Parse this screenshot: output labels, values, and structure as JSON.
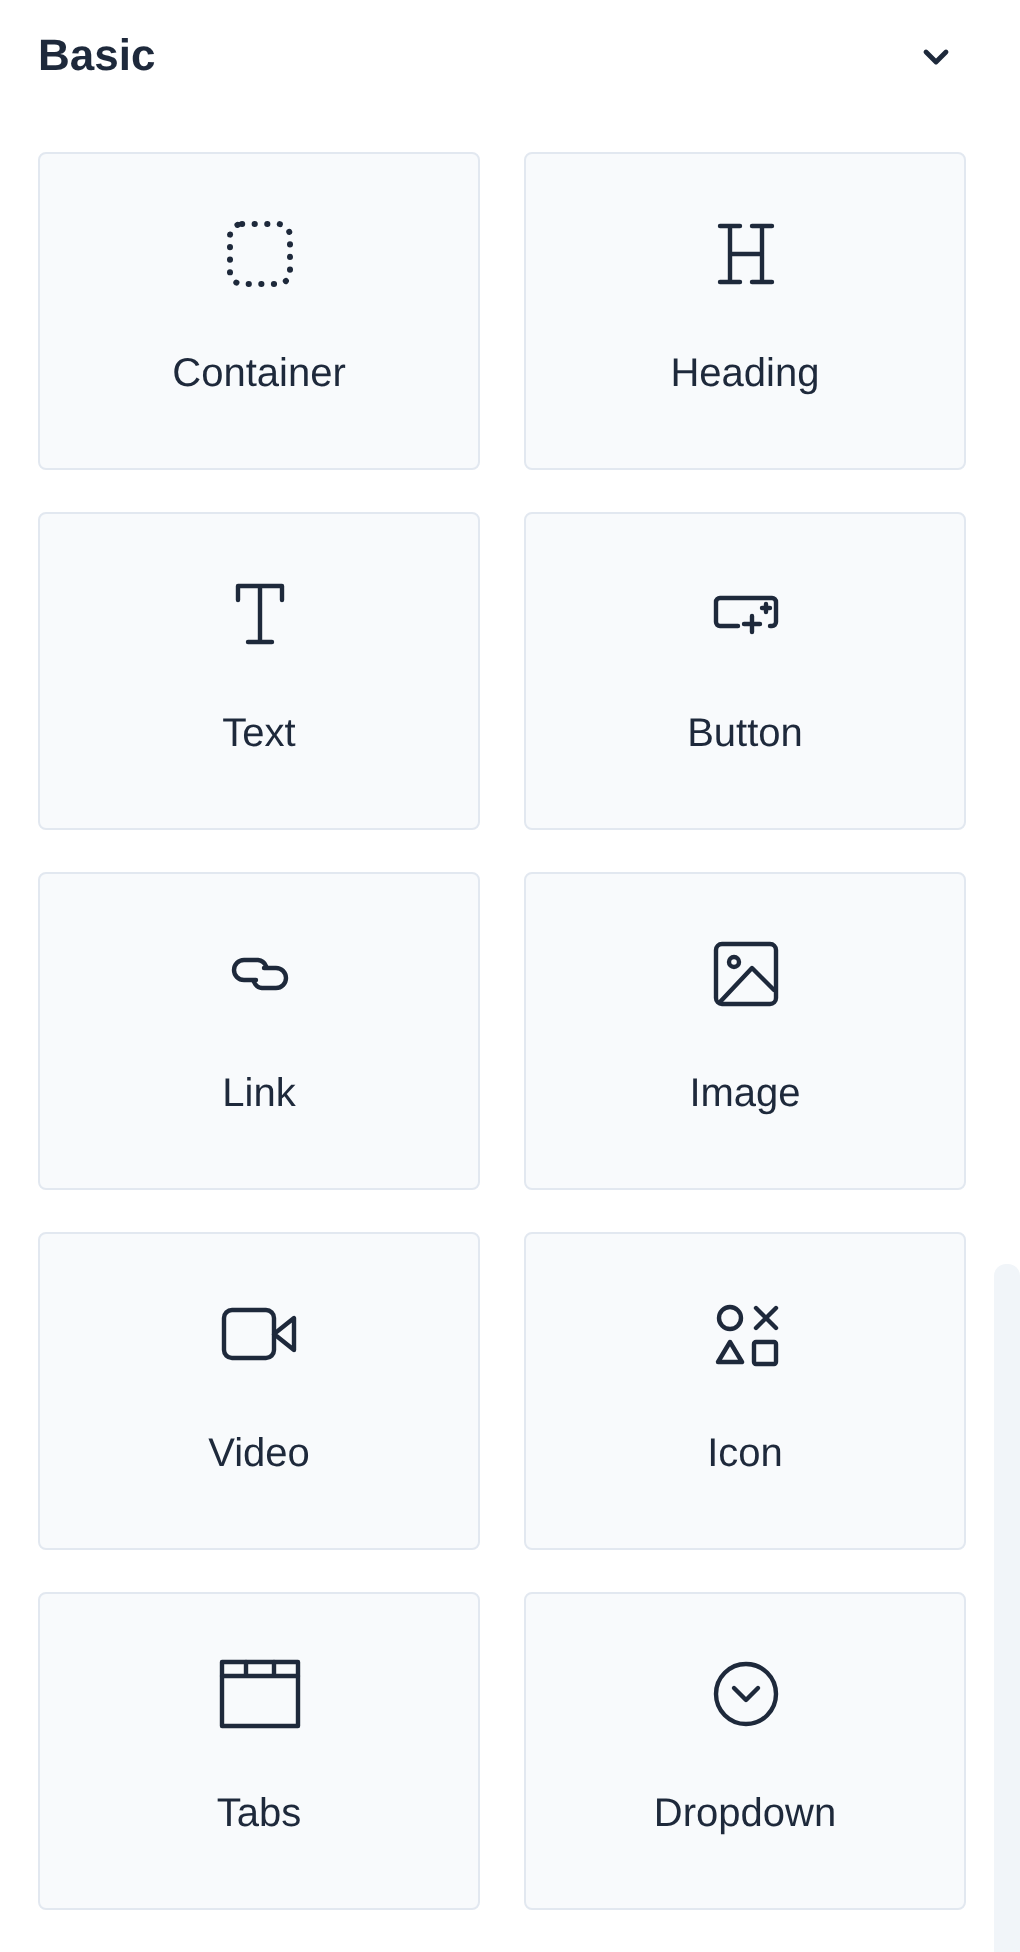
{
  "section": {
    "title": "Basic",
    "expanded": true
  },
  "items": [
    {
      "kind": "container",
      "label": "Container"
    },
    {
      "kind": "heading",
      "label": "Heading"
    },
    {
      "kind": "text",
      "label": "Text"
    },
    {
      "kind": "button",
      "label": "Button"
    },
    {
      "kind": "link",
      "label": "Link"
    },
    {
      "kind": "image",
      "label": "Image"
    },
    {
      "kind": "video",
      "label": "Video"
    },
    {
      "kind": "icon",
      "label": "Icon"
    },
    {
      "kind": "tabs",
      "label": "Tabs"
    },
    {
      "kind": "dropdown",
      "label": "Dropdown"
    }
  ]
}
